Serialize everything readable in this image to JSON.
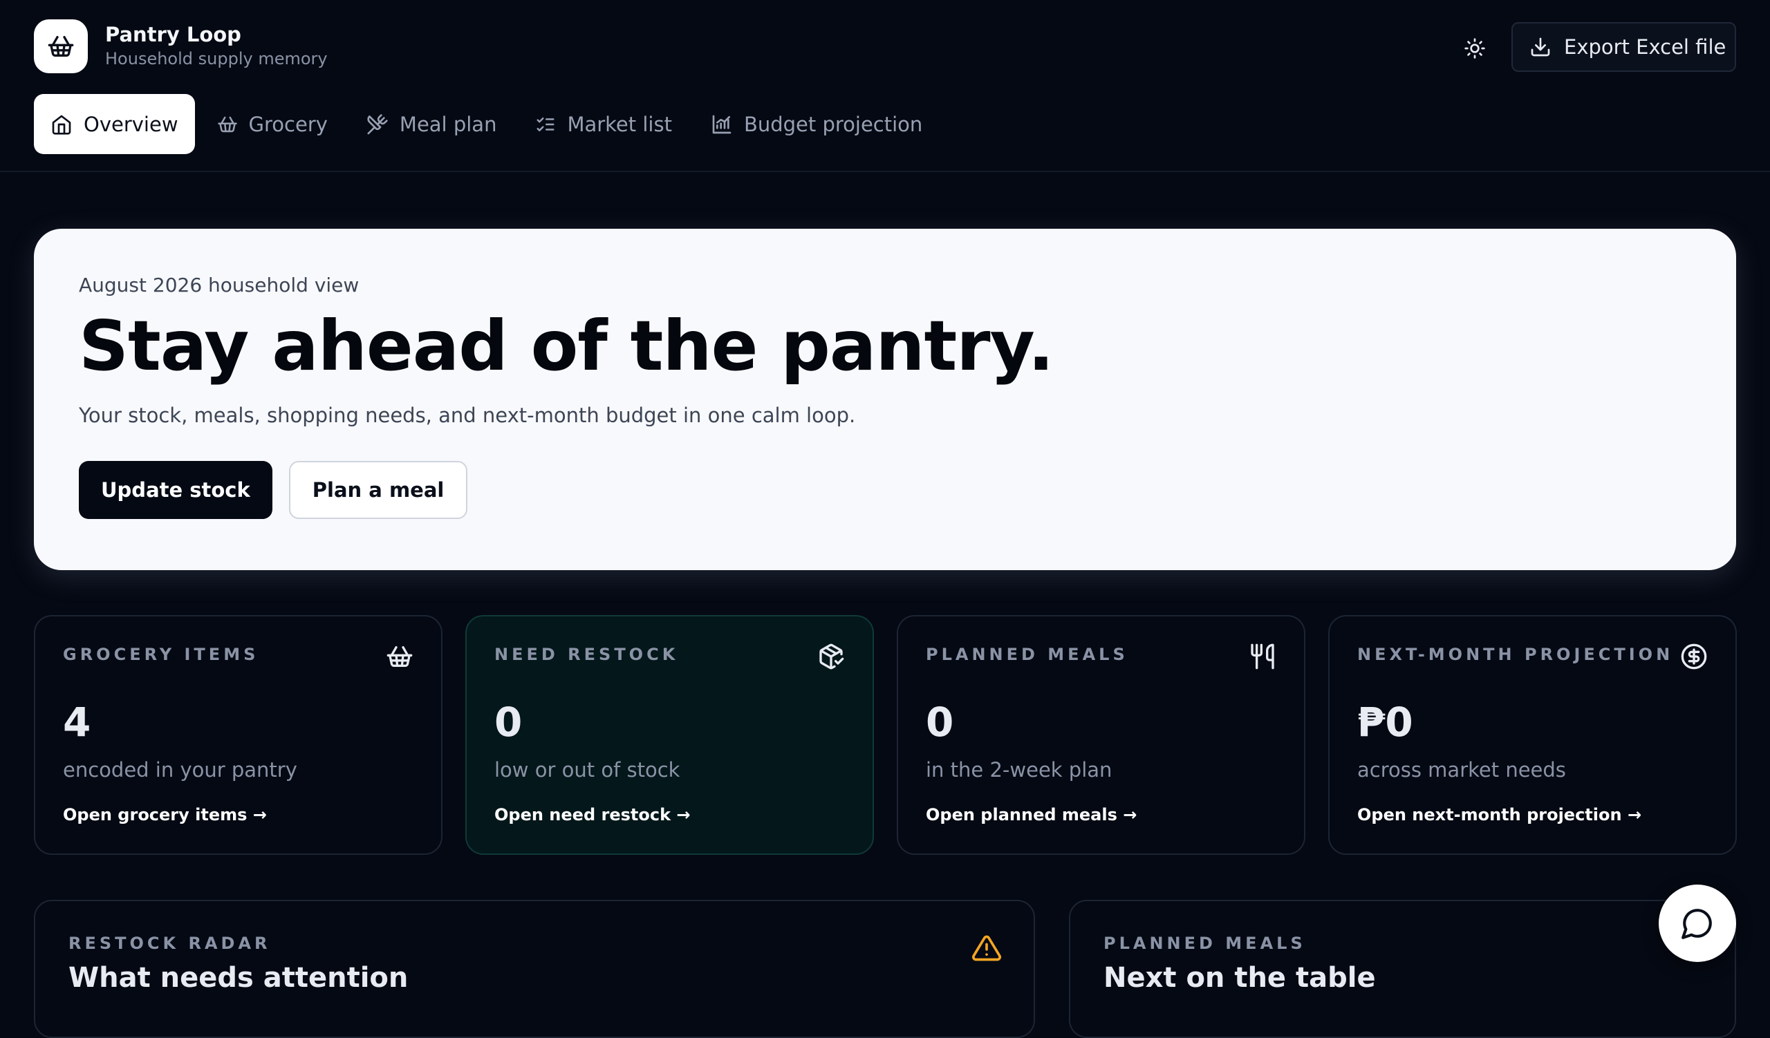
{
  "app": {
    "title": "Pantry Loop",
    "subtitle": "Household supply memory",
    "logo_icon": "basket-icon"
  },
  "header": {
    "theme_toggle_icon": "sun-icon",
    "export_label": "Export Excel file",
    "export_icon": "download-icon"
  },
  "nav": {
    "tabs": [
      {
        "label": "Overview",
        "icon": "home-icon",
        "active": true
      },
      {
        "label": "Grocery",
        "icon": "basket-icon",
        "active": false
      },
      {
        "label": "Meal plan",
        "icon": "utensils-crossed-icon",
        "active": false
      },
      {
        "label": "Market list",
        "icon": "list-checks-icon",
        "active": false
      },
      {
        "label": "Budget projection",
        "icon": "chart-icon",
        "active": false
      }
    ]
  },
  "hero": {
    "eyebrow": "August 2026 household view",
    "title": "Stay ahead of the pantry.",
    "subtitle": "Your stock, meals, shopping needs, and next-month budget in one calm loop.",
    "primary_label": "Update stock",
    "secondary_label": "Plan a meal"
  },
  "stats": [
    {
      "label": "GROCERY ITEMS",
      "value": "4",
      "desc": "encoded in your pantry",
      "link": "Open grocery items →",
      "icon": "basket-icon"
    },
    {
      "label": "NEED RESTOCK",
      "value": "0",
      "desc": "low or out of stock",
      "link": "Open need restock →",
      "icon": "package-check-icon"
    },
    {
      "label": "PLANNED MEALS",
      "value": "0",
      "desc": "in the 2-week plan",
      "link": "Open planned meals →",
      "icon": "utensils-icon"
    },
    {
      "label": "NEXT-MONTH PROJECTION",
      "value": "₱0",
      "desc": "across market needs",
      "link": "Open next-month projection →",
      "icon": "dollar-circle-icon"
    }
  ],
  "panels": {
    "restock": {
      "label": "RESTOCK RADAR",
      "title": "What needs attention",
      "icon": "warning-icon"
    },
    "meals": {
      "label": "PLANNED MEALS",
      "title": "Next on the table"
    }
  },
  "chat": {
    "icon": "chat-bubble-icon"
  },
  "colors": {
    "background": "#050913",
    "hero_background": "#f8f9fc",
    "highlight_card": "#04171a",
    "warning": "#f5a524",
    "muted_text": "#8a93a6"
  }
}
